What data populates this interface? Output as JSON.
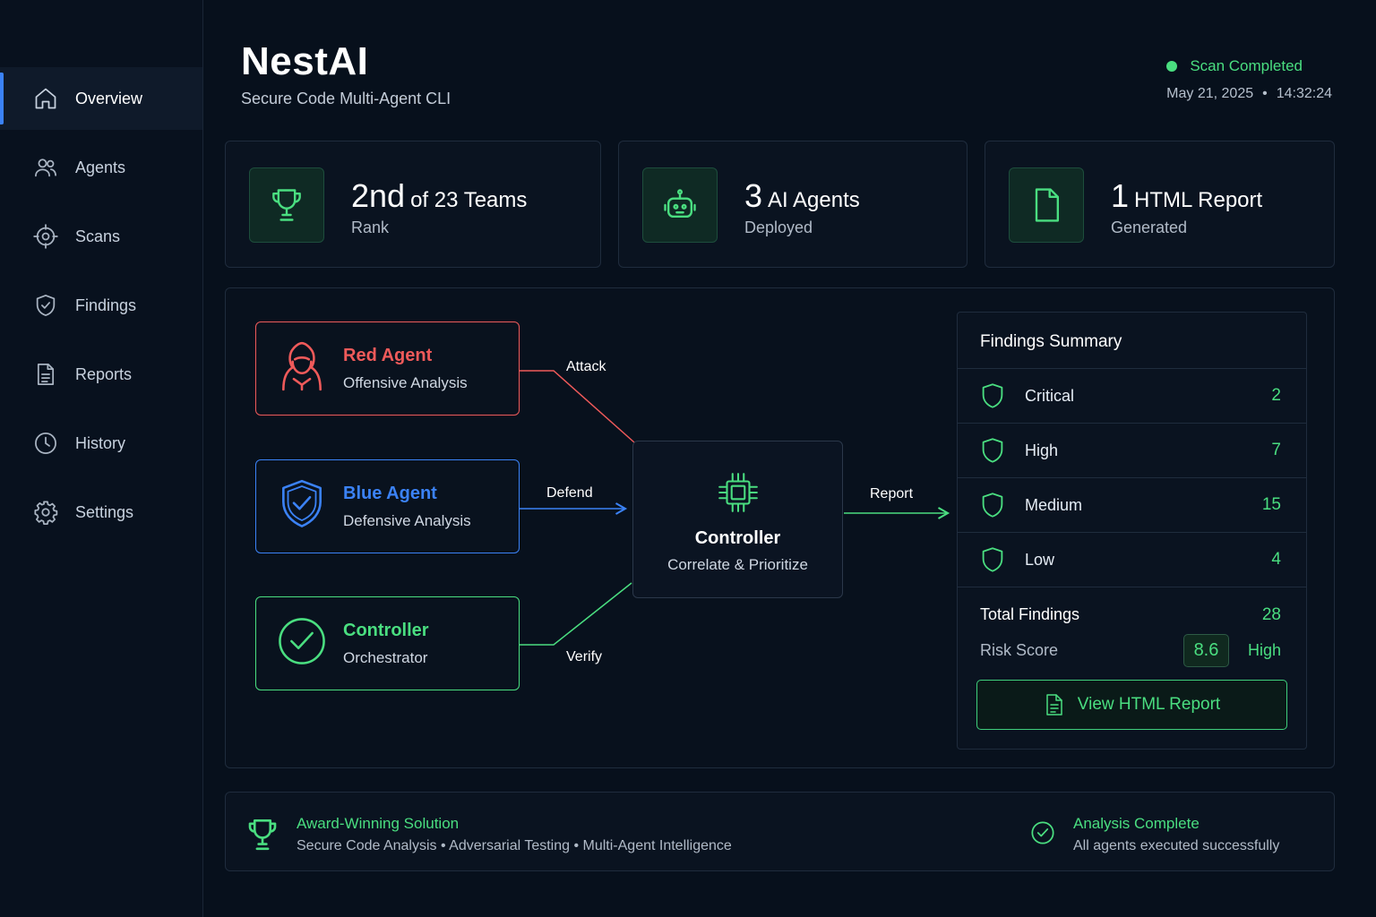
{
  "app": {
    "title": "NestAI",
    "subtitle": "Secure Code Multi-Agent CLI"
  },
  "status": {
    "text": "Scan Completed",
    "date": "May 21, 2025",
    "separator": "•",
    "time": "14:32:24"
  },
  "sidebar": {
    "items": [
      {
        "label": "Overview",
        "icon": "home-icon",
        "active": true
      },
      {
        "label": "Agents",
        "icon": "users-icon"
      },
      {
        "label": "Scans",
        "icon": "crosshair-icon"
      },
      {
        "label": "Findings",
        "icon": "shield-icon"
      },
      {
        "label": "Reports",
        "icon": "document-icon"
      },
      {
        "label": "History",
        "icon": "clock-icon"
      },
      {
        "label": "Settings",
        "icon": "gear-icon"
      }
    ]
  },
  "stats": [
    {
      "big": "2nd",
      "rest": "of 23 Teams",
      "sub": "Rank",
      "icon": "trophy-icon"
    },
    {
      "big": "3",
      "rest": "AI Agents",
      "sub": "Deployed",
      "icon": "robot-icon"
    },
    {
      "big": "1",
      "rest": "HTML Report",
      "sub": "Generated",
      "icon": "file-icon"
    }
  ],
  "diagram": {
    "agents": [
      {
        "title": "Red Agent",
        "subtitle": "Offensive Analysis",
        "color": "#ef5a5a",
        "icon": "hooded-hacker-icon"
      },
      {
        "title": "Blue Agent",
        "subtitle": "Defensive Analysis",
        "color": "#3b82f6",
        "icon": "shield-check-icon"
      },
      {
        "title": "Controller",
        "subtitle": "Orchestrator",
        "color": "#4ade80",
        "icon": "check-circle-icon"
      }
    ],
    "controller": {
      "title": "Controller",
      "subtitle": "Correlate & Prioritize",
      "icon": "cpu-chip-icon"
    },
    "connections": {
      "attack": "Attack",
      "defend": "Defend",
      "verify": "Verify",
      "report": "Report"
    }
  },
  "findings": {
    "title": "Findings Summary",
    "rows": [
      {
        "label": "Critical",
        "count": "2"
      },
      {
        "label": "High",
        "count": "7"
      },
      {
        "label": "Medium",
        "count": "15"
      },
      {
        "label": "Low",
        "count": "4"
      }
    ],
    "total_label": "Total Findings",
    "total_value": "28",
    "risk_label": "Risk Score",
    "risk_value": "8.6",
    "risk_level": "High",
    "button_label": "View HTML Report"
  },
  "banner": {
    "title": "Award-Winning Solution",
    "subtitle": "Secure Code Analysis • Adversarial Testing • Multi-Agent Intelligence",
    "status_title": "Analysis Complete",
    "status_subtitle": "All agents executed successfully"
  },
  "colors": {
    "accent_green": "#4ade80",
    "accent_blue": "#3b82f6",
    "accent_red": "#ef5a5a",
    "background": "#07101c"
  }
}
